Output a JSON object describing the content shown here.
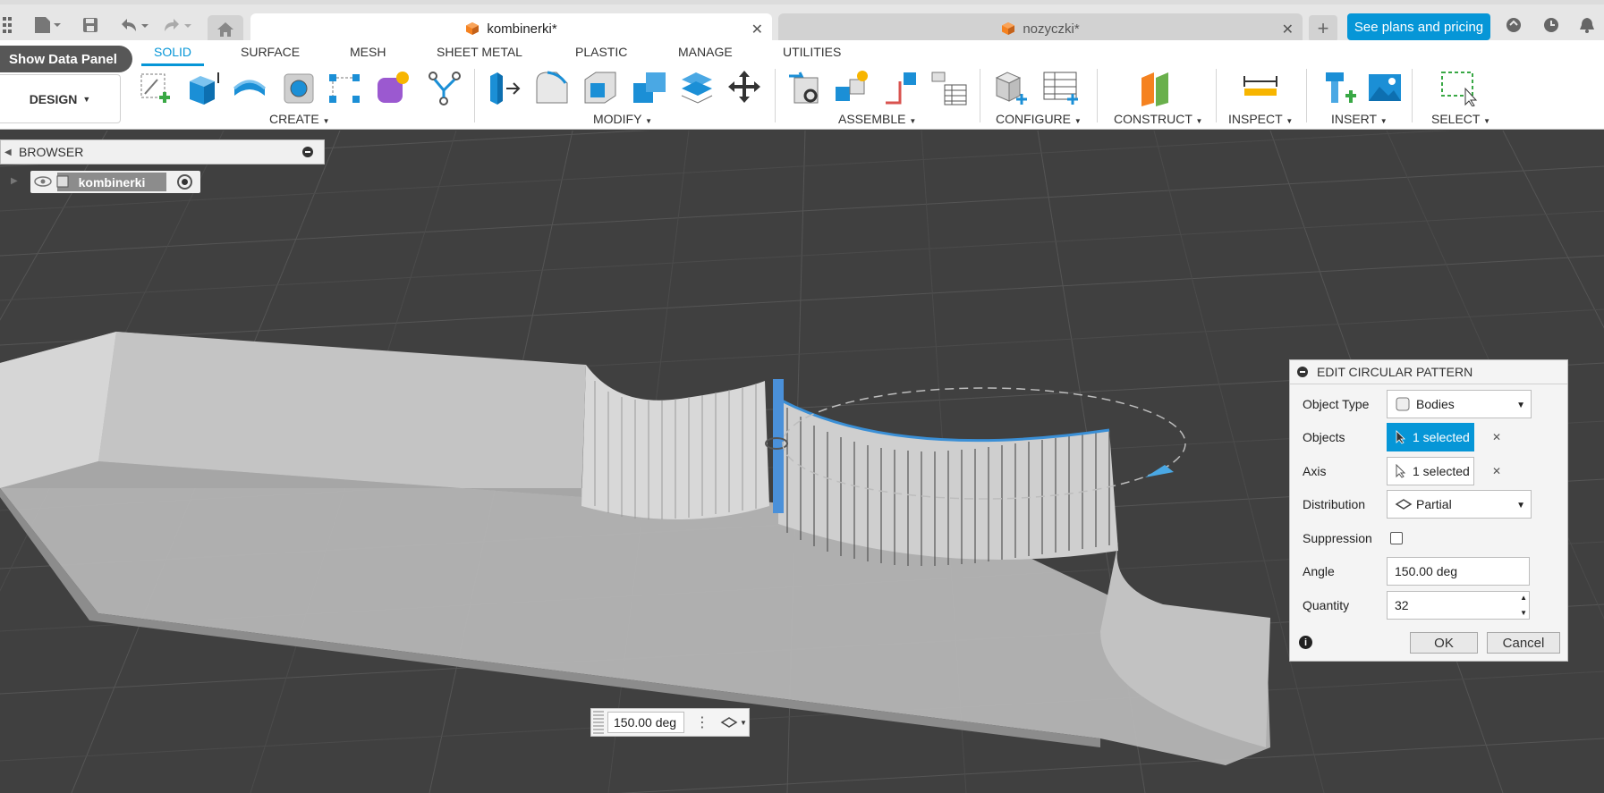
{
  "tabs": {
    "active_title": "kombinerki*",
    "inactive_title": "nozyczki*",
    "plans_button": "See plans and pricing"
  },
  "ribbon": {
    "data_panel_button": "Show Data Panel",
    "design_button": "DESIGN",
    "tabs": [
      "SOLID",
      "SURFACE",
      "MESH",
      "SHEET METAL",
      "PLASTIC",
      "MANAGE",
      "UTILITIES"
    ],
    "groups": [
      "CREATE",
      "MODIFY",
      "ASSEMBLE",
      "CONFIGURE",
      "CONSTRUCT",
      "INSPECT",
      "INSERT",
      "SELECT"
    ]
  },
  "browser": {
    "title": "BROWSER",
    "root_component": "kombinerki"
  },
  "dialog": {
    "title": "EDIT CIRCULAR PATTERN",
    "object_type_label": "Object Type",
    "object_type_value": "Bodies",
    "objects_label": "Objects",
    "objects_value": "1 selected",
    "axis_label": "Axis",
    "axis_value": "1 selected",
    "distribution_label": "Distribution",
    "distribution_value": "Partial",
    "suppression_label": "Suppression",
    "angle_label": "Angle",
    "angle_value": "150.00 deg",
    "quantity_label": "Quantity",
    "quantity_value": "32",
    "ok_label": "OK",
    "cancel_label": "Cancel"
  },
  "viewport": {
    "angle_input_value": "150.00 deg"
  },
  "colors": {
    "accent": "#0696d7",
    "viewport_bg": "#404040",
    "orange_doc": "#f58220"
  }
}
